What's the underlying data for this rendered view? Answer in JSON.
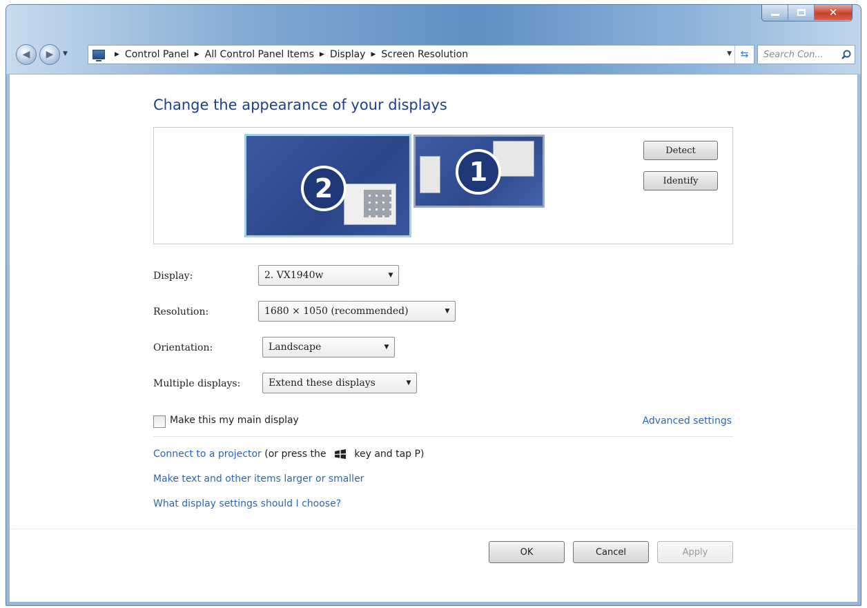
{
  "window": {
    "breadcrumbs": [
      "Control Panel",
      "All Control Panel Items",
      "Display",
      "Screen Resolution"
    ],
    "search_placeholder": "Search Con...",
    "icons": {
      "back": "back-arrow-icon",
      "forward": "forward-arrow-icon",
      "refresh": "refresh-icon",
      "search": "search-icon",
      "close": "close-icon",
      "minimize": "minimize-icon",
      "maximize": "maximize-icon"
    }
  },
  "page": {
    "heading": "Change the appearance of your displays",
    "monitors": [
      {
        "number": "2",
        "selected": true
      },
      {
        "number": "1",
        "selected": false
      }
    ],
    "detect_label": "Detect",
    "identify_label": "Identify"
  },
  "form": {
    "display_label": "Display:",
    "display_value": "2. VX1940w",
    "resolution_label": "Resolution:",
    "resolution_value": "1680 × 1050 (recommended)",
    "orientation_label": "Orientation:",
    "orientation_value": "Landscape",
    "multiple_label": "Multiple displays:",
    "multiple_value": "Extend these displays",
    "main_display_label": "Make this my main display",
    "main_display_checked": false,
    "advanced_link": "Advanced settings"
  },
  "links": {
    "projector": "Connect to a projector",
    "projector_note_pre": "(or press the",
    "projector_note_post": "key and tap P)",
    "text_size": "Make text and other items larger or smaller",
    "which_settings": "What display settings should I choose?"
  },
  "buttons": {
    "ok": "OK",
    "cancel": "Cancel",
    "apply": "Apply"
  },
  "colors": {
    "heading": "#1e3f8a",
    "link": "#2a66b8",
    "selection": "#9ed2f5"
  }
}
